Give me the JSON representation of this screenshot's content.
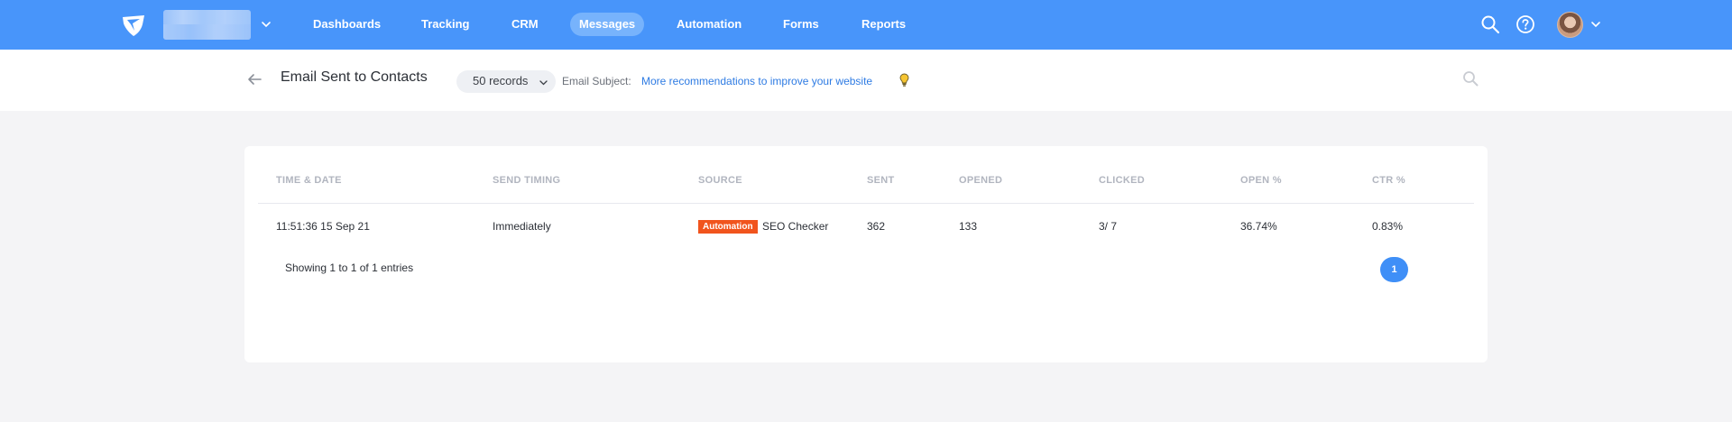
{
  "colors": {
    "nav_bg": "#4895fa",
    "nav_active": "#77b3fc",
    "link": "#2e7be3",
    "badge": "#f1541d",
    "pagination": "#3f8ff7"
  },
  "topbar": {
    "logo_icon": "paper-plane-shield-icon",
    "account_name": "",
    "nav": [
      {
        "label": "Dashboards",
        "active": false
      },
      {
        "label": "Tracking",
        "active": false
      },
      {
        "label": "CRM",
        "active": false
      },
      {
        "label": "Messages",
        "active": true
      },
      {
        "label": "Automation",
        "active": false
      },
      {
        "label": "Forms",
        "active": false
      },
      {
        "label": "Reports",
        "active": false
      }
    ],
    "icons": [
      "search-icon",
      "help-icon",
      "avatar",
      "chevron-down-icon"
    ]
  },
  "subheader": {
    "title": "Email Sent to Contacts",
    "records": "50 records",
    "subject_label": "Email Subject:",
    "subject_value": "More recommendations to improve your website"
  },
  "table": {
    "columns": [
      "TIME & DATE",
      "SEND TIMING",
      "SOURCE",
      "SENT",
      "OPENED",
      "CLICKED",
      "OPEN %",
      "CTR %"
    ],
    "rows": [
      {
        "time_date": "11:51:36 15 Sep 21",
        "send_timing": "Immediately",
        "source_badge": "Automation",
        "source_name": "SEO Checker",
        "sent": "362",
        "opened": "133",
        "clicked": "3/ 7",
        "open_pct": "36.74%",
        "ctr_pct": "0.83%"
      }
    ],
    "entries_text": "Showing 1 to 1 of 1 entries",
    "current_page": "1"
  }
}
